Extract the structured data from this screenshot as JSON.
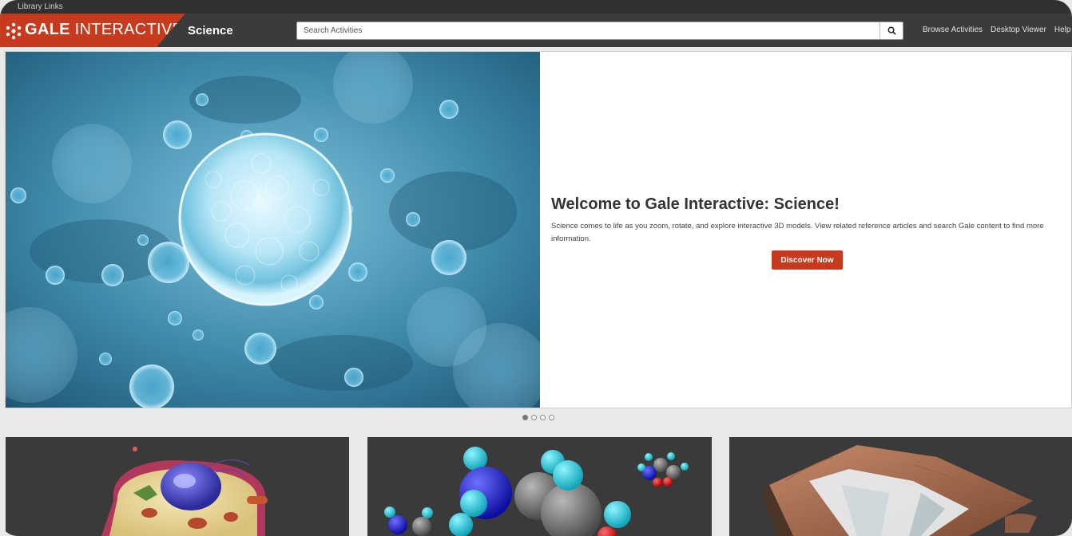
{
  "top_bar": {
    "library_links": "Library Links"
  },
  "header": {
    "brand_bold": "GALE",
    "brand_light": " INTERACTIVE",
    "subject": "Science",
    "search_placeholder": "Search Activities",
    "nav": [
      "Browse Activities",
      "Desktop Viewer",
      "Help"
    ]
  },
  "hero": {
    "title": "Welcome to Gale Interactive: Science!",
    "description": "Science comes to life as you zoom, rotate, and explore interactive 3D models. View related reference articles and search Gale content to find more information.",
    "button": "Discover Now"
  },
  "carousel": {
    "slide_count": 4,
    "active_index": 0
  },
  "colors": {
    "brand_red": "#c73a1e",
    "nav_bg": "#3b3b3b",
    "strip_bg": "#303030",
    "page_bg": "#e9e9e9",
    "card_bg": "#3a3a3a"
  },
  "icons": [
    "gale-logo-icon",
    "search-icon"
  ],
  "cards": [
    "animal-cell-model",
    "molecule-model",
    "terrain-model"
  ]
}
